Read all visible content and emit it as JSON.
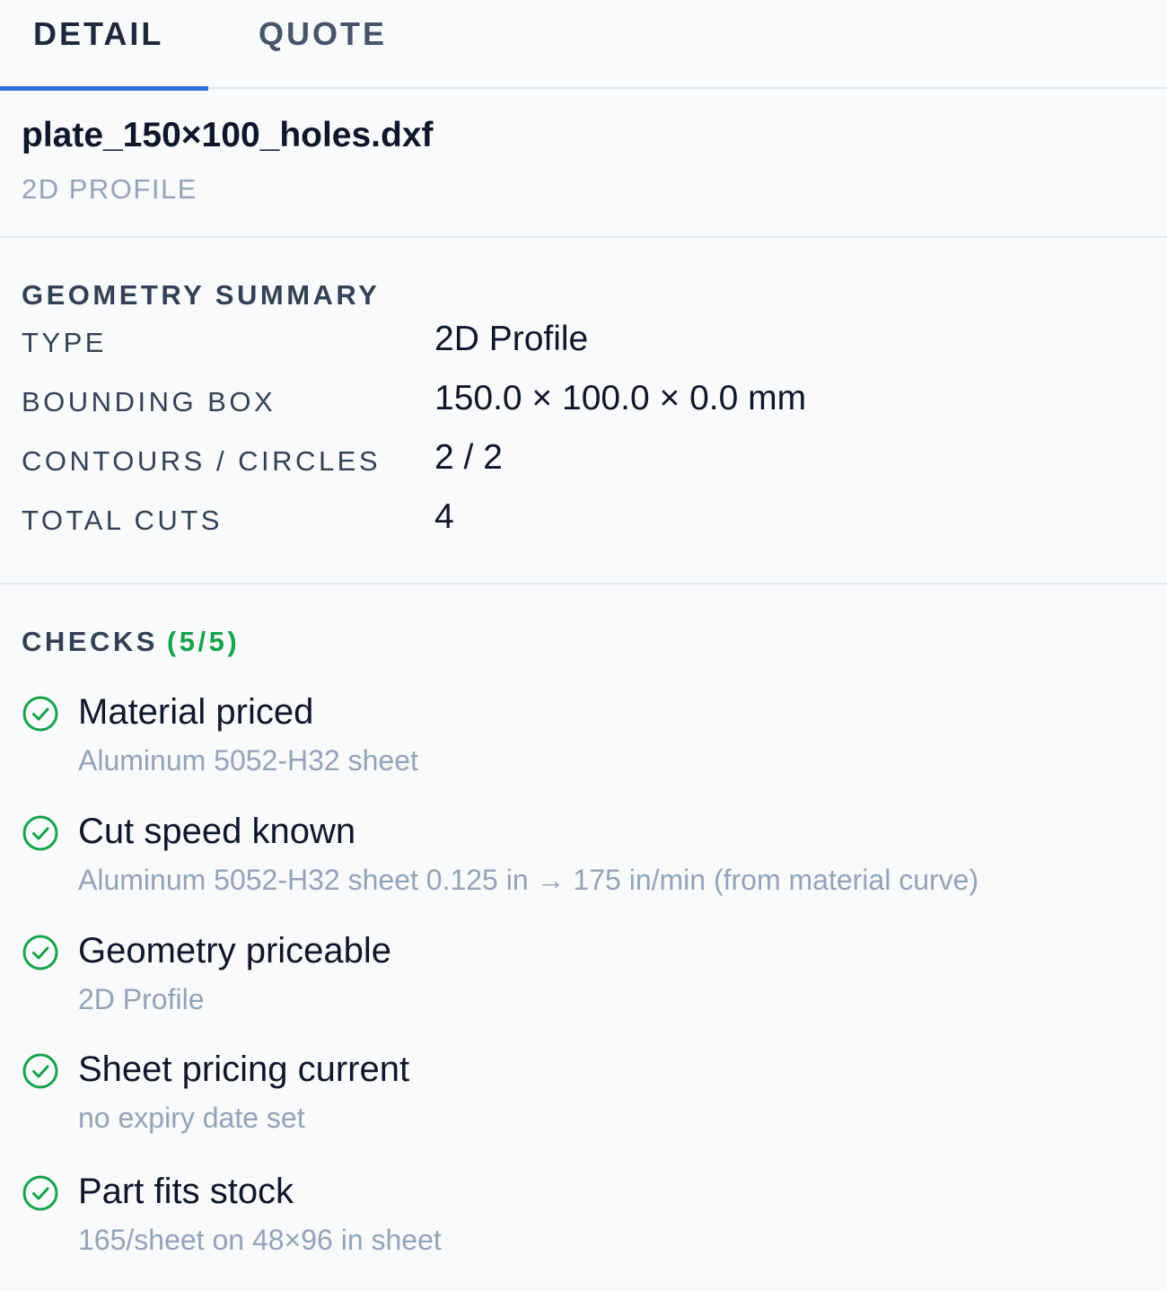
{
  "tabs": [
    {
      "label": "DETAIL",
      "active": true
    },
    {
      "label": "QUOTE",
      "active": false
    }
  ],
  "file": {
    "name": "plate_150×100_holes.dxf",
    "type": "2D PROFILE"
  },
  "geometry": {
    "title": "GEOMETRY SUMMARY",
    "rows": [
      {
        "label": "TYPE",
        "value": "2D Profile"
      },
      {
        "label": "BOUNDING BOX",
        "value": "150.0 × 100.0 × 0.0 mm"
      },
      {
        "label": "CONTOURS / CIRCLES",
        "value": "2 / 2"
      },
      {
        "label": "TOTAL CUTS",
        "value": "4"
      }
    ]
  },
  "checks": {
    "title": "CHECKS",
    "count": "(5/5)",
    "items": [
      {
        "title": "Material priced",
        "detail": "Aluminum 5052-H32 sheet",
        "status": "pass"
      },
      {
        "title": "Cut speed known",
        "detail": "Aluminum 5052-H32 sheet 0.125 in → 175 in/min (from material curve)",
        "status": "pass"
      },
      {
        "title": "Geometry priceable",
        "detail": "2D Profile",
        "status": "pass"
      },
      {
        "title": "Sheet pricing current",
        "detail": "no expiry date set",
        "status": "pass"
      },
      {
        "title": "Part fits stock",
        "detail": "165/sheet on 48×96 in sheet",
        "status": "pass"
      }
    ]
  },
  "colors": {
    "accent": "#2f6fdc",
    "success": "#16a34a",
    "muted": "#94a3b8",
    "background": "#f8fafc"
  },
  "icons": {
    "check": "check-circle-icon"
  }
}
